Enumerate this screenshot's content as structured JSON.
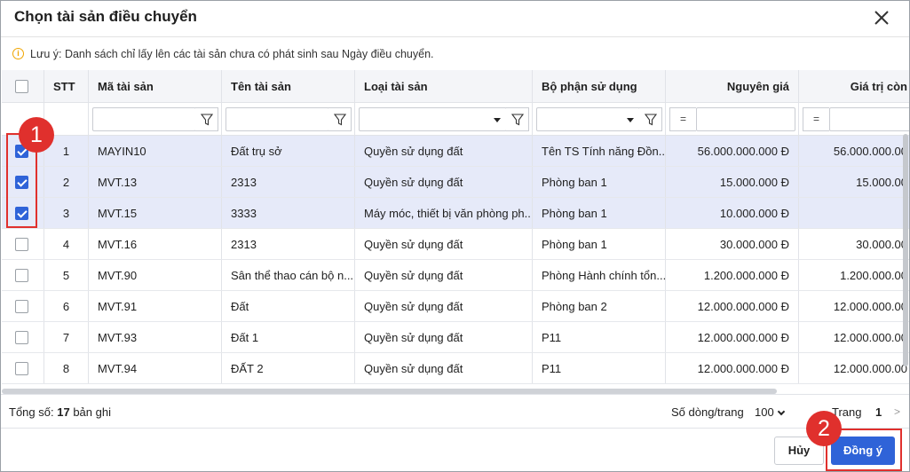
{
  "dialog": {
    "title": "Chọn tài sản điều chuyển",
    "close_icon": "close-icon",
    "note_icon": "info-icon",
    "note": "Lưu ý: Danh sách chỉ lấy lên các tài sản chưa có phát sinh sau Ngày điều chuyển."
  },
  "table": {
    "headers": {
      "stt": "STT",
      "code": "Mã tài sản",
      "name": "Tên tài sản",
      "type": "Loại tài sản",
      "dept": "Bộ phận sử dụng",
      "cost": "Nguyên giá",
      "remain": "Giá trị còn"
    },
    "filter": {
      "eq1": "=",
      "eq2": "="
    },
    "rows": [
      {
        "checked": true,
        "stt": "1",
        "code": "MAYIN10",
        "name": "Đất trụ sở",
        "type": "Quyền sử dụng đất",
        "dept": "Tên TS Tính năng Đồn...",
        "cost": "56.000.000.000 Đ",
        "remain": "56.000.000.00"
      },
      {
        "checked": true,
        "stt": "2",
        "code": "MVT.13",
        "name": "2313",
        "type": "Quyền sử dụng đất",
        "dept": "Phòng ban 1",
        "cost": "15.000.000 Đ",
        "remain": "15.000.00"
      },
      {
        "checked": true,
        "stt": "3",
        "code": "MVT.15",
        "name": "3333",
        "type": "Máy móc, thiết bị văn phòng ph...",
        "dept": "Phòng ban 1",
        "cost": "10.000.000 Đ",
        "remain": ""
      },
      {
        "checked": false,
        "stt": "4",
        "code": "MVT.16",
        "name": "2313",
        "type": "Quyền sử dụng đất",
        "dept": "Phòng ban 1",
        "cost": "30.000.000 Đ",
        "remain": "30.000.00"
      },
      {
        "checked": false,
        "stt": "5",
        "code": "MVT.90",
        "name": "Sân thể thao cán bộ n...",
        "type": "Quyền sử dụng đất",
        "dept": "Phòng Hành chính tổn...",
        "cost": "1.200.000.000 Đ",
        "remain": "1.200.000.00"
      },
      {
        "checked": false,
        "stt": "6",
        "code": "MVT.91",
        "name": "Đất",
        "type": "Quyền sử dụng đất",
        "dept": "Phòng ban 2",
        "cost": "12.000.000.000 Đ",
        "remain": "12.000.000.00"
      },
      {
        "checked": false,
        "stt": "7",
        "code": "MVT.93",
        "name": "Đất 1",
        "type": "Quyền sử dụng đất",
        "dept": "P11",
        "cost": "12.000.000.000 Đ",
        "remain": "12.000.000.00"
      },
      {
        "checked": false,
        "stt": "8",
        "code": "MVT.94",
        "name": "ĐẤT 2",
        "type": "Quyền sử dụng đất",
        "dept": "P11",
        "cost": "12.000.000.000 Đ",
        "remain": "12.000.000.00"
      }
    ]
  },
  "footer": {
    "total_label": "Tổng số:",
    "total_count": "17",
    "total_suffix": "bản ghi",
    "page_size_label": "Số dòng/trang",
    "page_size": "100",
    "page_label": "Trang",
    "page_number": "1",
    "next": ">"
  },
  "actions": {
    "cancel": "Hủy",
    "ok": "Đồng ý"
  },
  "annotations": {
    "badge1": "1",
    "badge2": "2",
    "color": "#e0302d"
  },
  "colors": {
    "accent": "#2f63d8",
    "selected_row": "#e6eaf9"
  }
}
